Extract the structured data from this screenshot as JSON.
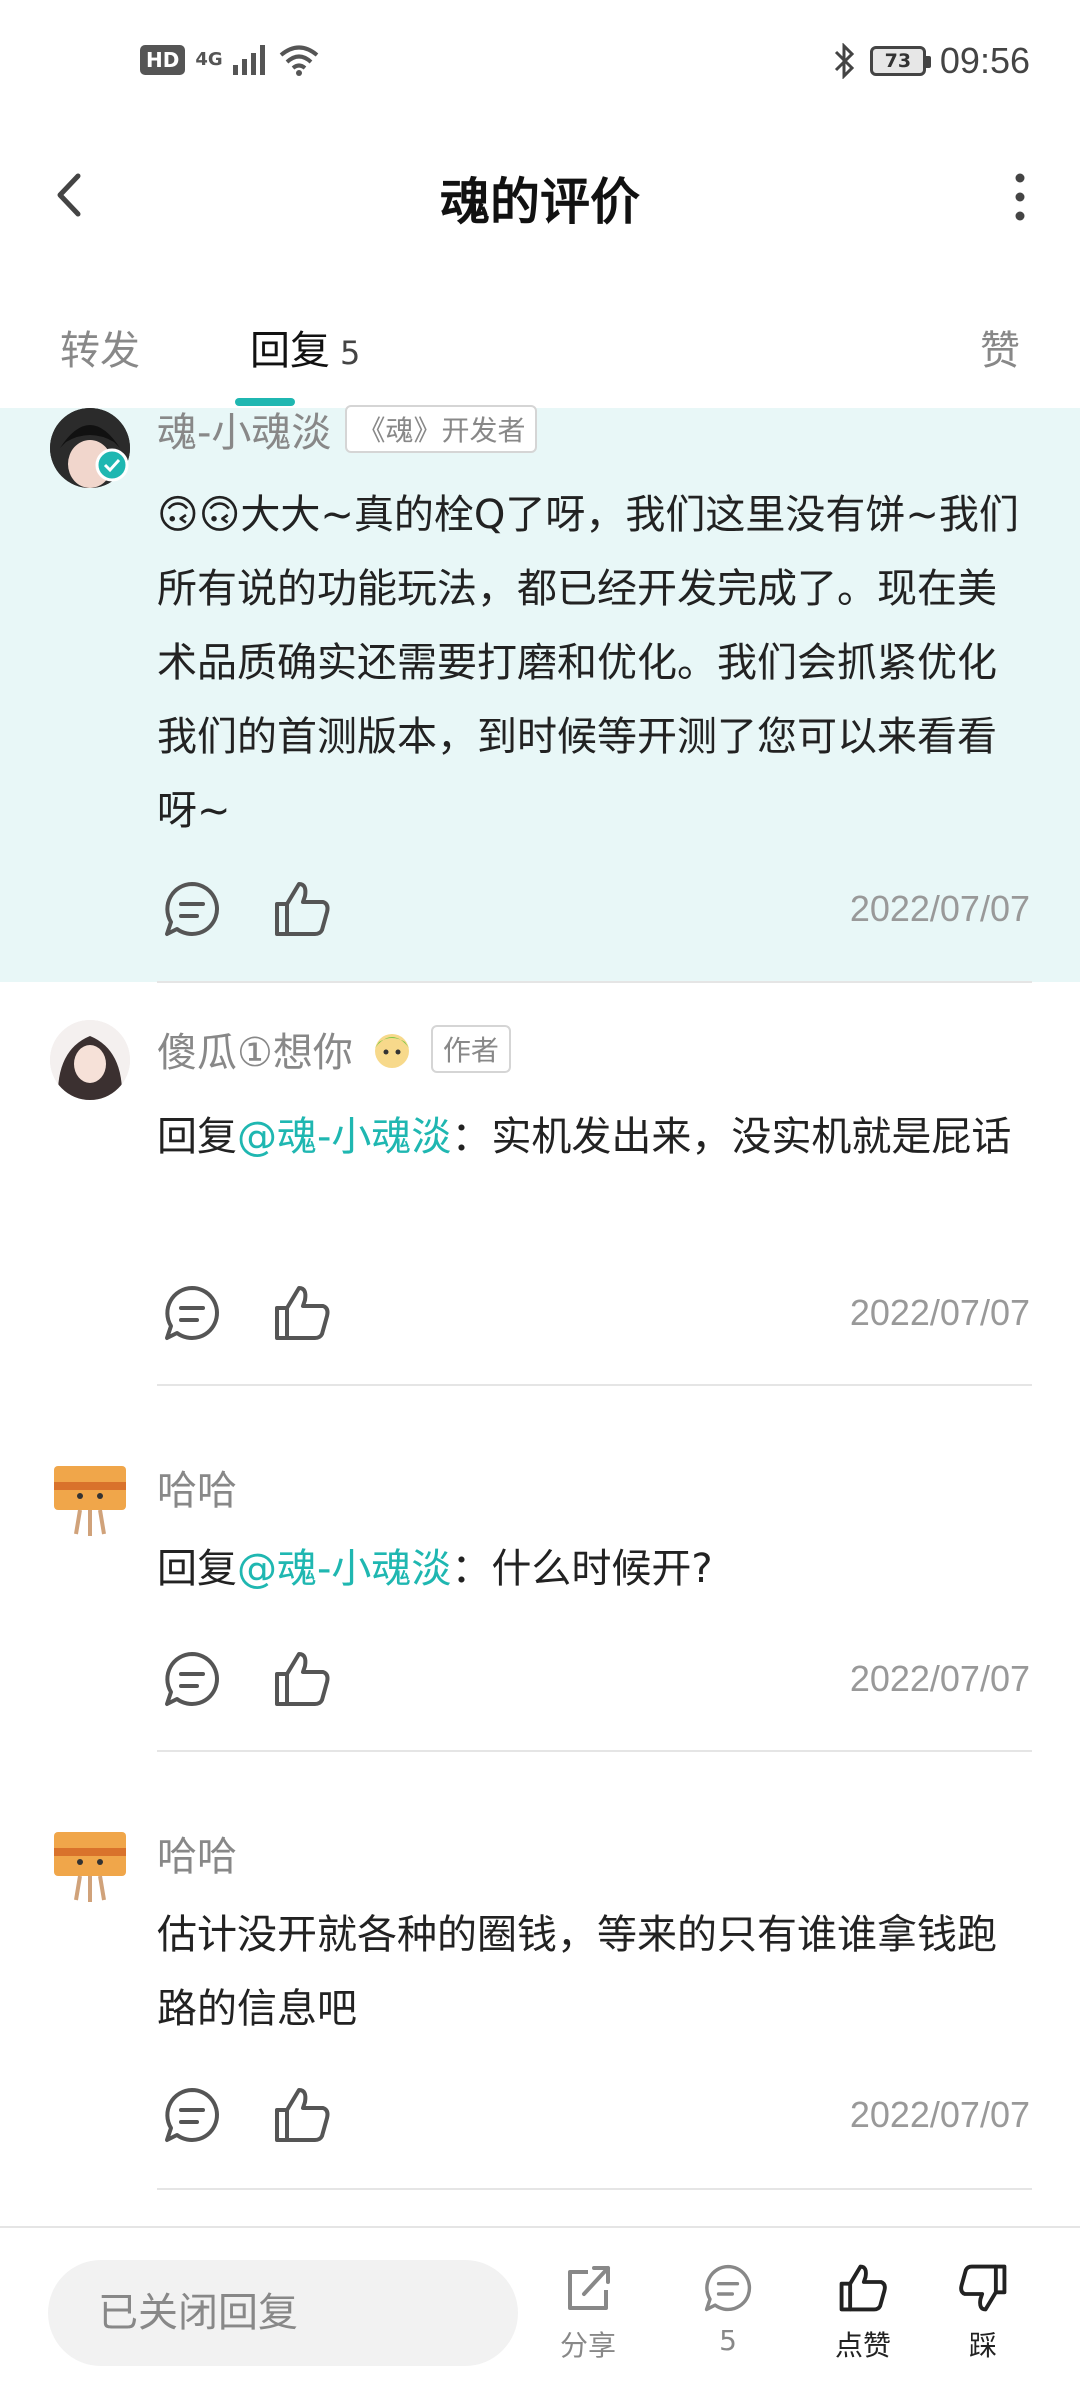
{
  "status_bar": {
    "hd": "HD",
    "network": "4G",
    "battery": "73",
    "time": "09:56"
  },
  "header": {
    "title": "魂的评价"
  },
  "tabs": {
    "forward": "转发",
    "reply": "回复",
    "reply_count": "5",
    "like": "赞"
  },
  "comments": [
    {
      "author": "魂-小魂淡",
      "badge": "《魂》开发者",
      "text": "🙃🙃大大~真的栓Q了呀，我们这里没有饼~我们所有说的功能玩法，都已经开发完成了。现在美术品质确实还需要打磨和优化。我们会抓紧优化我们的首测版本，到时候等开测了您可以来看看呀~",
      "date": "2022/07/07"
    },
    {
      "author": "傻瓜①想你",
      "badge": "作者",
      "reply_prefix": "回复",
      "mention": "@魂-小魂淡",
      "text": "：实机发出来，没实机就是屁话",
      "date": "2022/07/07"
    },
    {
      "author": "哈哈",
      "reply_prefix": "回复",
      "mention": "@魂-小魂淡",
      "text": "：什么时候开?",
      "date": "2022/07/07"
    },
    {
      "author": "哈哈",
      "text": "估计没开就各种的圈钱，等来的只有谁谁拿钱跑路的信息吧",
      "date": "2022/07/07"
    }
  ],
  "bottom_bar": {
    "input_placeholder": "已关闭回复",
    "share_label": "分享",
    "comment_count": "5",
    "like_label": "点赞",
    "dislike_label": "踩"
  },
  "colors": {
    "accent": "#1fb7b1",
    "highlight_bg": "#e8f7f7",
    "muted_text": "#888888"
  },
  "icons": [
    "back-icon",
    "more-icon",
    "verified-icon",
    "comment-icon",
    "thumb-up-icon",
    "share-icon",
    "thumb-down-icon"
  ]
}
